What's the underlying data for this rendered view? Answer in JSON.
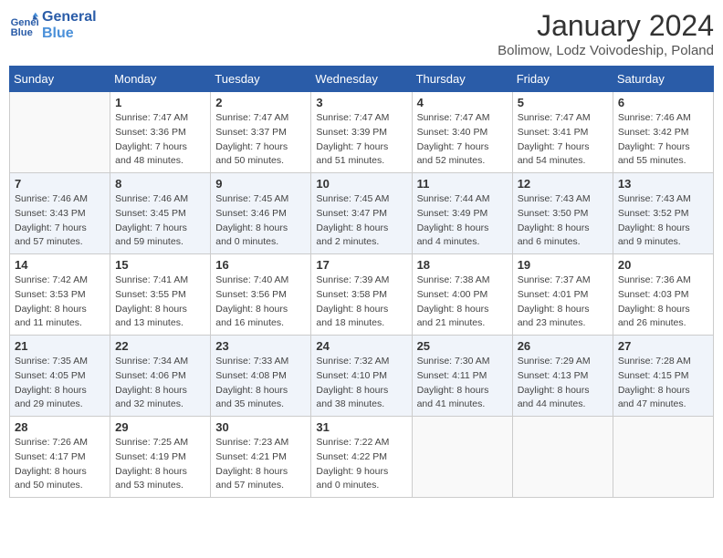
{
  "logo": {
    "line1": "General",
    "line2": "Blue"
  },
  "title": "January 2024",
  "subtitle": "Bolimow, Lodz Voivodeship, Poland",
  "weekdays": [
    "Sunday",
    "Monday",
    "Tuesday",
    "Wednesday",
    "Thursday",
    "Friday",
    "Saturday"
  ],
  "weeks": [
    [
      {
        "day": "",
        "info": ""
      },
      {
        "day": "1",
        "info": "Sunrise: 7:47 AM\nSunset: 3:36 PM\nDaylight: 7 hours\nand 48 minutes."
      },
      {
        "day": "2",
        "info": "Sunrise: 7:47 AM\nSunset: 3:37 PM\nDaylight: 7 hours\nand 50 minutes."
      },
      {
        "day": "3",
        "info": "Sunrise: 7:47 AM\nSunset: 3:39 PM\nDaylight: 7 hours\nand 51 minutes."
      },
      {
        "day": "4",
        "info": "Sunrise: 7:47 AM\nSunset: 3:40 PM\nDaylight: 7 hours\nand 52 minutes."
      },
      {
        "day": "5",
        "info": "Sunrise: 7:47 AM\nSunset: 3:41 PM\nDaylight: 7 hours\nand 54 minutes."
      },
      {
        "day": "6",
        "info": "Sunrise: 7:46 AM\nSunset: 3:42 PM\nDaylight: 7 hours\nand 55 minutes."
      }
    ],
    [
      {
        "day": "7",
        "info": "Sunrise: 7:46 AM\nSunset: 3:43 PM\nDaylight: 7 hours\nand 57 minutes."
      },
      {
        "day": "8",
        "info": "Sunrise: 7:46 AM\nSunset: 3:45 PM\nDaylight: 7 hours\nand 59 minutes."
      },
      {
        "day": "9",
        "info": "Sunrise: 7:45 AM\nSunset: 3:46 PM\nDaylight: 8 hours\nand 0 minutes."
      },
      {
        "day": "10",
        "info": "Sunrise: 7:45 AM\nSunset: 3:47 PM\nDaylight: 8 hours\nand 2 minutes."
      },
      {
        "day": "11",
        "info": "Sunrise: 7:44 AM\nSunset: 3:49 PM\nDaylight: 8 hours\nand 4 minutes."
      },
      {
        "day": "12",
        "info": "Sunrise: 7:43 AM\nSunset: 3:50 PM\nDaylight: 8 hours\nand 6 minutes."
      },
      {
        "day": "13",
        "info": "Sunrise: 7:43 AM\nSunset: 3:52 PM\nDaylight: 8 hours\nand 9 minutes."
      }
    ],
    [
      {
        "day": "14",
        "info": "Sunrise: 7:42 AM\nSunset: 3:53 PM\nDaylight: 8 hours\nand 11 minutes."
      },
      {
        "day": "15",
        "info": "Sunrise: 7:41 AM\nSunset: 3:55 PM\nDaylight: 8 hours\nand 13 minutes."
      },
      {
        "day": "16",
        "info": "Sunrise: 7:40 AM\nSunset: 3:56 PM\nDaylight: 8 hours\nand 16 minutes."
      },
      {
        "day": "17",
        "info": "Sunrise: 7:39 AM\nSunset: 3:58 PM\nDaylight: 8 hours\nand 18 minutes."
      },
      {
        "day": "18",
        "info": "Sunrise: 7:38 AM\nSunset: 4:00 PM\nDaylight: 8 hours\nand 21 minutes."
      },
      {
        "day": "19",
        "info": "Sunrise: 7:37 AM\nSunset: 4:01 PM\nDaylight: 8 hours\nand 23 minutes."
      },
      {
        "day": "20",
        "info": "Sunrise: 7:36 AM\nSunset: 4:03 PM\nDaylight: 8 hours\nand 26 minutes."
      }
    ],
    [
      {
        "day": "21",
        "info": "Sunrise: 7:35 AM\nSunset: 4:05 PM\nDaylight: 8 hours\nand 29 minutes."
      },
      {
        "day": "22",
        "info": "Sunrise: 7:34 AM\nSunset: 4:06 PM\nDaylight: 8 hours\nand 32 minutes."
      },
      {
        "day": "23",
        "info": "Sunrise: 7:33 AM\nSunset: 4:08 PM\nDaylight: 8 hours\nand 35 minutes."
      },
      {
        "day": "24",
        "info": "Sunrise: 7:32 AM\nSunset: 4:10 PM\nDaylight: 8 hours\nand 38 minutes."
      },
      {
        "day": "25",
        "info": "Sunrise: 7:30 AM\nSunset: 4:11 PM\nDaylight: 8 hours\nand 41 minutes."
      },
      {
        "day": "26",
        "info": "Sunrise: 7:29 AM\nSunset: 4:13 PM\nDaylight: 8 hours\nand 44 minutes."
      },
      {
        "day": "27",
        "info": "Sunrise: 7:28 AM\nSunset: 4:15 PM\nDaylight: 8 hours\nand 47 minutes."
      }
    ],
    [
      {
        "day": "28",
        "info": "Sunrise: 7:26 AM\nSunset: 4:17 PM\nDaylight: 8 hours\nand 50 minutes."
      },
      {
        "day": "29",
        "info": "Sunrise: 7:25 AM\nSunset: 4:19 PM\nDaylight: 8 hours\nand 53 minutes."
      },
      {
        "day": "30",
        "info": "Sunrise: 7:23 AM\nSunset: 4:21 PM\nDaylight: 8 hours\nand 57 minutes."
      },
      {
        "day": "31",
        "info": "Sunrise: 7:22 AM\nSunset: 4:22 PM\nDaylight: 9 hours\nand 0 minutes."
      },
      {
        "day": "",
        "info": ""
      },
      {
        "day": "",
        "info": ""
      },
      {
        "day": "",
        "info": ""
      }
    ]
  ]
}
